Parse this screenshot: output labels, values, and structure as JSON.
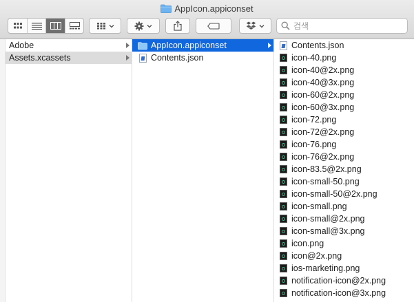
{
  "window": {
    "title": "AppIcon.appiconset"
  },
  "toolbar": {
    "view_modes": [
      "icon-view",
      "list-view",
      "column-view",
      "gallery-view"
    ],
    "active_view": "column-view",
    "group_icon": "group-grid-icon",
    "action_icon": "gear-icon",
    "share_icon": "share-icon",
    "tag_icon": "tag-icon",
    "dropbox_icon": "dropbox-icon"
  },
  "search": {
    "placeholder": "검색",
    "value": ""
  },
  "columns": {
    "col1": [
      {
        "label": "Adobe",
        "has_children": true,
        "selected": false
      },
      {
        "label": "Assets.xcassets",
        "has_children": true,
        "selected": true
      }
    ],
    "col2": [
      {
        "label": "AppIcon.appiconset",
        "type": "folder",
        "has_children": true,
        "selected": true
      },
      {
        "label": "Contents.json",
        "type": "json",
        "has_children": false,
        "selected": false
      }
    ],
    "col3": [
      {
        "label": "Contents.json",
        "type": "json"
      },
      {
        "label": "icon-40.png",
        "type": "png"
      },
      {
        "label": "icon-40@2x.png",
        "type": "png"
      },
      {
        "label": "icon-40@3x.png",
        "type": "png"
      },
      {
        "label": "icon-60@2x.png",
        "type": "png"
      },
      {
        "label": "icon-60@3x.png",
        "type": "png"
      },
      {
        "label": "icon-72.png",
        "type": "png"
      },
      {
        "label": "icon-72@2x.png",
        "type": "png"
      },
      {
        "label": "icon-76.png",
        "type": "png"
      },
      {
        "label": "icon-76@2x.png",
        "type": "png"
      },
      {
        "label": "icon-83.5@2x.png",
        "type": "png"
      },
      {
        "label": "icon-small-50.png",
        "type": "png"
      },
      {
        "label": "icon-small-50@2x.png",
        "type": "png"
      },
      {
        "label": "icon-small.png",
        "type": "png"
      },
      {
        "label": "icon-small@2x.png",
        "type": "png"
      },
      {
        "label": "icon-small@3x.png",
        "type": "png"
      },
      {
        "label": "icon.png",
        "type": "png"
      },
      {
        "label": "icon@2x.png",
        "type": "png"
      },
      {
        "label": "ios-marketing.png",
        "type": "png"
      },
      {
        "label": "notification-icon@2x.png",
        "type": "png"
      },
      {
        "label": "notification-icon@3x.png",
        "type": "png"
      }
    ]
  },
  "colors": {
    "selection_blue": "#1167dd",
    "selection_grey": "#dcdcdc",
    "folder_blue": "#6fb4f0"
  }
}
